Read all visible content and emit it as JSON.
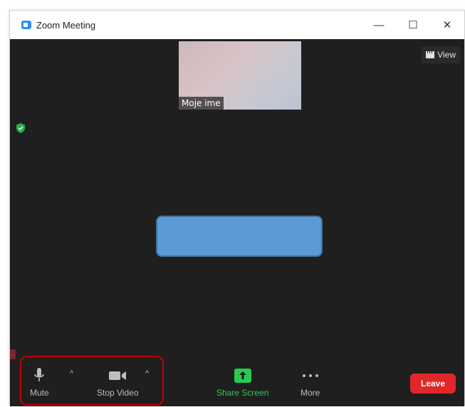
{
  "window": {
    "title": "Zoom Meeting",
    "controls": {
      "minimize": "—",
      "maximize": "☐",
      "close": "✕"
    }
  },
  "meeting": {
    "participant_name": "Moje ime",
    "view_label": "View"
  },
  "toolbar": {
    "mute_label": "Mute",
    "stop_video_label": "Stop Video",
    "share_screen_label": "Share Screen",
    "more_label": "More",
    "leave_label": "Leave",
    "caret": "^"
  },
  "colors": {
    "share_green": "#2dca52",
    "leave_red": "#e02828",
    "highlight_red": "#c00000",
    "redaction_blue": "#5b9bd5"
  }
}
